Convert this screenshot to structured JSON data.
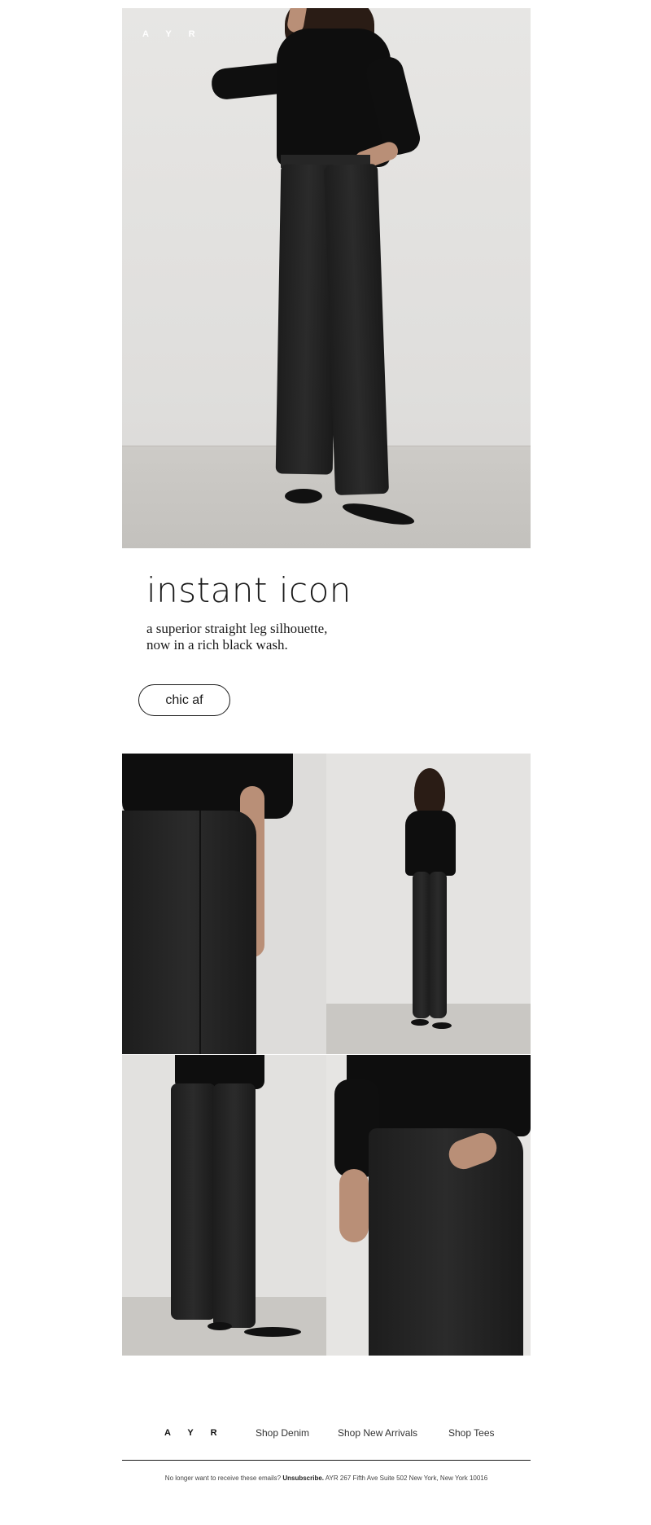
{
  "brand": {
    "logo_text": "AYR"
  },
  "hero": {
    "image_alt": "model in black shirt and black straight leg jeans"
  },
  "copy": {
    "headline": "instant icon",
    "subcopy_line1": "a superior straight leg silhouette,",
    "subcopy_line2": "now in a rich black wash.",
    "cta_label": "chic af"
  },
  "grid": {
    "tiles": [
      {
        "alt": "back view of black jeans"
      },
      {
        "alt": "full length front view"
      },
      {
        "alt": "front view, lower body"
      },
      {
        "alt": "close-up of front pocket"
      }
    ]
  },
  "footer": {
    "logo_text": "AYR",
    "links": [
      "Shop Denim",
      "Shop New Arrivals",
      "Shop Tees"
    ],
    "legal_prefix": "No longer want to receive these emails?",
    "unsubscribe_label": "Unsubscribe.",
    "address": "AYR 267 Fifth Ave Suite 502 New York, New York 10016"
  },
  "colors": {
    "text": "#1a1a1a",
    "background": "#ffffff",
    "garment": "#0e0e0e"
  }
}
